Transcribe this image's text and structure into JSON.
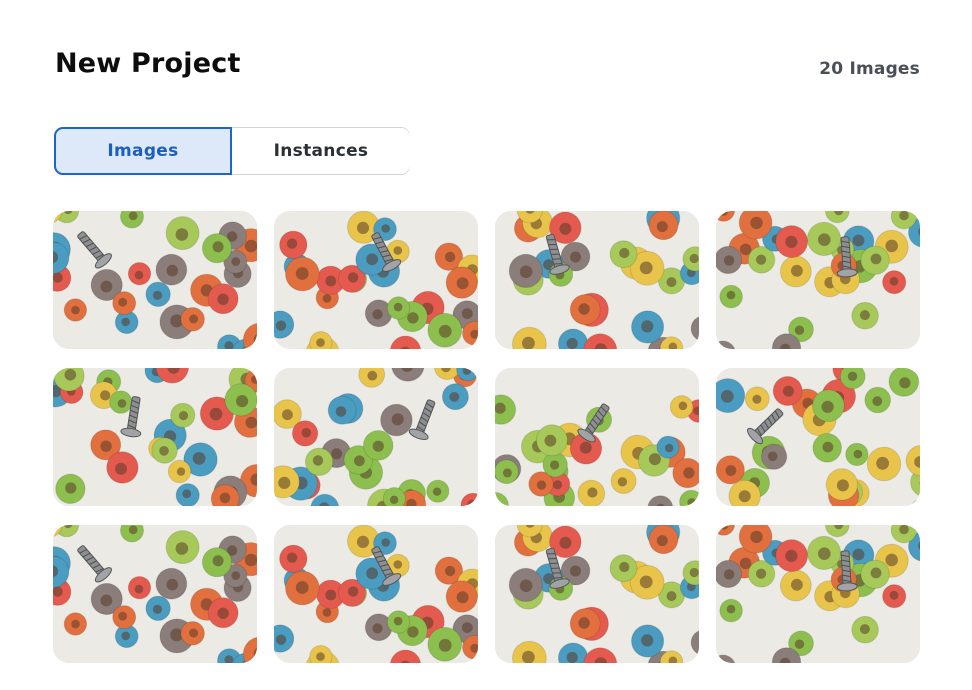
{
  "header": {
    "title": "New Project",
    "count_label": "20 Images"
  },
  "tabs": [
    {
      "label": "Images",
      "active": true
    },
    {
      "label": "Instances",
      "active": false
    }
  ],
  "colors": {
    "accent": "#1b66c9",
    "active_tab_bg": "#dde9f8",
    "cereal_palette": [
      "#e2703f",
      "#e8c54a",
      "#8cbf4e",
      "#4a9cc0",
      "#8a7d7a",
      "#e55a4e",
      "#a7c95a"
    ]
  },
  "gallery": {
    "thumbnails": [
      {
        "icon": "cereal-photo",
        "variant": 1
      },
      {
        "icon": "cereal-photo",
        "variant": 2
      },
      {
        "icon": "cereal-photo",
        "variant": 3
      },
      {
        "icon": "cereal-photo",
        "variant": 4
      },
      {
        "icon": "cereal-photo",
        "variant": 5
      },
      {
        "icon": "cereal-photo",
        "variant": 6
      },
      {
        "icon": "cereal-photo",
        "variant": 7
      },
      {
        "icon": "cereal-photo",
        "variant": 8
      },
      {
        "icon": "cereal-photo",
        "variant": 1
      },
      {
        "icon": "cereal-photo",
        "variant": 2
      },
      {
        "icon": "cereal-photo",
        "variant": 3
      },
      {
        "icon": "cereal-photo",
        "variant": 4
      }
    ]
  }
}
